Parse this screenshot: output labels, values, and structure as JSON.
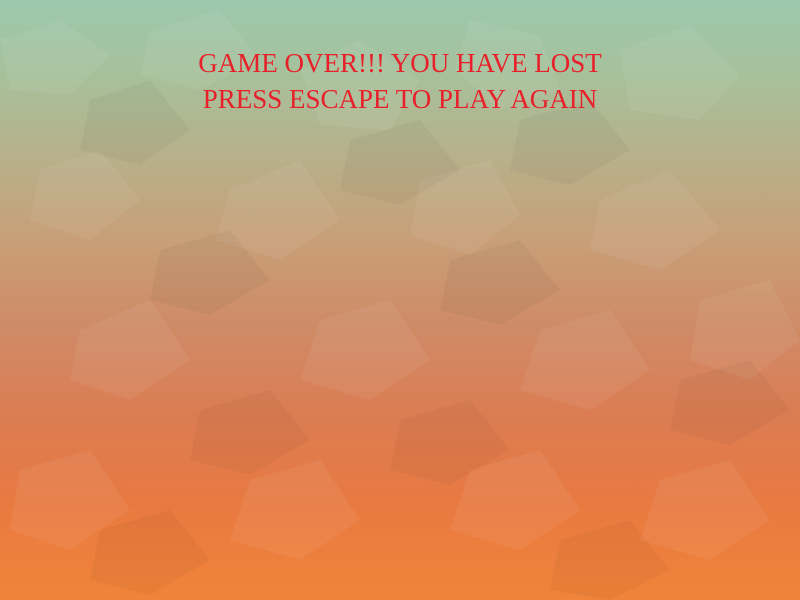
{
  "game_over": {
    "line1": "GAME OVER!!! YOU HAVE LOST",
    "line2": "PRESS ESCAPE TO PLAY AGAIN"
  },
  "colors": {
    "text": "#e8202a",
    "background_top": "#9cc8ad",
    "background_middle": "#c89f78",
    "background_bottom": "#f0843a"
  }
}
